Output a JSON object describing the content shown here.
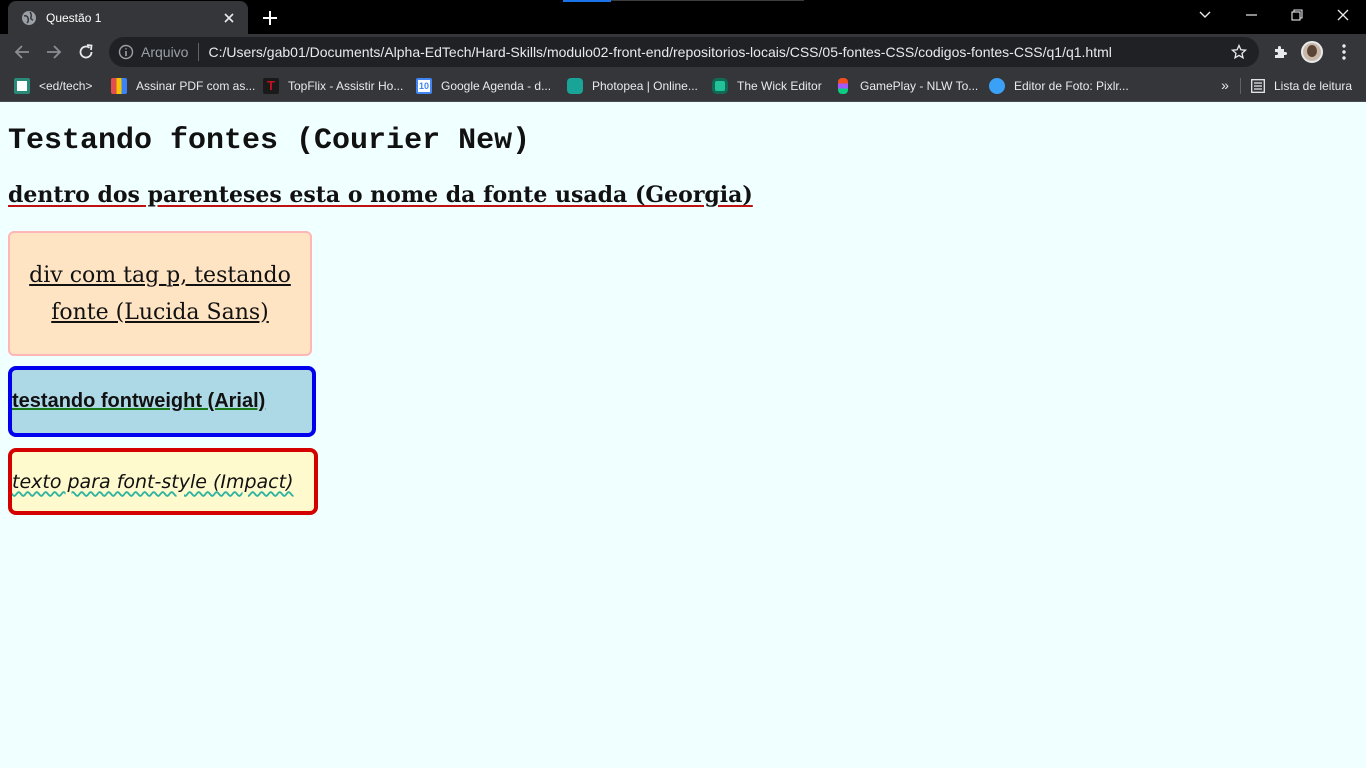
{
  "browser": {
    "tab": {
      "title": "Questão 1"
    },
    "omnibox": {
      "scheme_label": "Arquivo",
      "url": "C:/Users/gab01/Documents/Alpha-EdTech/Hard-Skills/modulo02-front-end/repositorios-locais/CSS/05-fontes-CSS/codigos-fontes-CSS/q1/q1.html"
    },
    "bookmarks": [
      {
        "label": "<ed/tech>",
        "icon_color": "#2a8a7a"
      },
      {
        "label": "Assinar PDF com as...",
        "icon_color": "#e34d4d"
      },
      {
        "label": "TopFlix - Assistir Ho...",
        "icon_color": "#c1121f"
      },
      {
        "label": "Google Agenda - d...",
        "icon_color": "#4285f4"
      },
      {
        "label": "Photopea | Online...",
        "icon_color": "#18a497"
      },
      {
        "label": "The Wick Editor",
        "icon_color": "#22c39a"
      },
      {
        "label": "GamePlay - NLW To...",
        "icon_color": "#f24e1e"
      },
      {
        "label": "Editor de Foto: Pixlr...",
        "icon_color": "#3ba1f7"
      }
    ],
    "overflow_label": "»",
    "reading_list_label": "Lista de leitura"
  },
  "page": {
    "title": "Testando fontes (Courier New)",
    "subtitle": "dentro dos parenteses esta o nome da fonte usada (Georgia)",
    "box_lucida": "div com tag p, testando fonte (Lucida Sans)",
    "box_arial": "testando fontweight (Arial)",
    "box_impact": "texto para font-style (Impact)"
  }
}
